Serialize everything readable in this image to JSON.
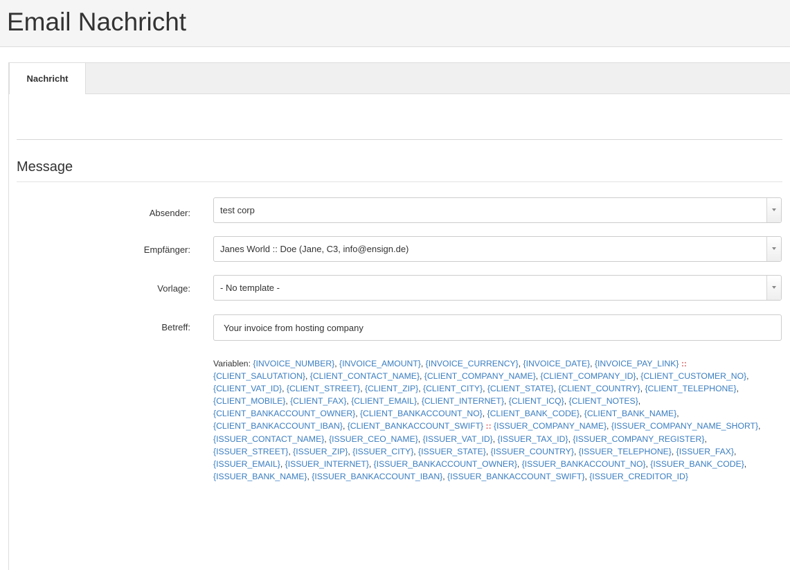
{
  "page": {
    "title": "Email Nachricht"
  },
  "tabs": [
    {
      "label": "Nachricht",
      "active": true
    }
  ],
  "section": {
    "title": "Message"
  },
  "form": {
    "sender": {
      "label": "Absender:",
      "value": "test corp"
    },
    "recipient": {
      "label": "Empfänger:",
      "value": "Janes World :: Doe (Jane, C3, info@ensign.de)"
    },
    "template": {
      "label": "Vorlage:",
      "value": "- No template -"
    },
    "subject": {
      "label": "Betreff:",
      "value": "Your invoice from hosting company"
    }
  },
  "variables": {
    "label": "Variablen: ",
    "separator": "::",
    "groups": [
      [
        "{INVOICE_NUMBER}",
        "{INVOICE_AMOUNT}",
        "{INVOICE_CURRENCY}",
        "{INVOICE_DATE}",
        "{INVOICE_PAY_LINK}"
      ],
      [
        "{CLIENT_SALUTATION}",
        "{CLIENT_CONTACT_NAME}",
        "{CLIENT_COMPANY_NAME}",
        "{CLIENT_COMPANY_ID}",
        "{CLIENT_CUSTOMER_NO}",
        "{CLIENT_VAT_ID}",
        "{CLIENT_STREET}",
        "{CLIENT_ZIP}",
        "{CLIENT_CITY}",
        "{CLIENT_STATE}",
        "{CLIENT_COUNTRY}",
        "{CLIENT_TELEPHONE}",
        "{CLIENT_MOBILE}",
        "{CLIENT_FAX}",
        "{CLIENT_EMAIL}",
        "{CLIENT_INTERNET}",
        "{CLIENT_ICQ}",
        "{CLIENT_NOTES}",
        "{CLIENT_BANKACCOUNT_OWNER}",
        "{CLIENT_BANKACCOUNT_NO}",
        "{CLIENT_BANK_CODE}",
        "{CLIENT_BANK_NAME}",
        "{CLIENT_BANKACCOUNT_IBAN}",
        "{CLIENT_BANKACCOUNT_SWIFT}"
      ],
      [
        "{ISSUER_COMPANY_NAME}",
        "{ISSUER_COMPANY_NAME_SHORT}",
        "{ISSUER_CONTACT_NAME}",
        "{ISSUER_CEO_NAME}",
        "{ISSUER_VAT_ID}",
        "{ISSUER_TAX_ID}",
        "{ISSUER_COMPANY_REGISTER}",
        "{ISSUER_STREET}",
        "{ISSUER_ZIP}",
        "{ISSUER_CITY}",
        "{ISSUER_STATE}",
        "{ISSUER_COUNTRY}",
        "{ISSUER_TELEPHONE}",
        "{ISSUER_FAX}",
        "{ISSUER_EMAIL}",
        "{ISSUER_INTERNET}",
        "{ISSUER_BANKACCOUNT_OWNER}",
        "{ISSUER_BANKACCOUNT_NO}",
        "{ISSUER_BANK_CODE}",
        "{ISSUER_BANK_NAME}",
        "{ISSUER_BANKACCOUNT_IBAN}",
        "{ISSUER_BANKACCOUNT_SWIFT}",
        "{ISSUER_CREDITOR_ID}"
      ]
    ]
  },
  "colors": {
    "link": "#3a7dc0",
    "separator": "#e06060",
    "header_bg": "#f5f5f5"
  }
}
